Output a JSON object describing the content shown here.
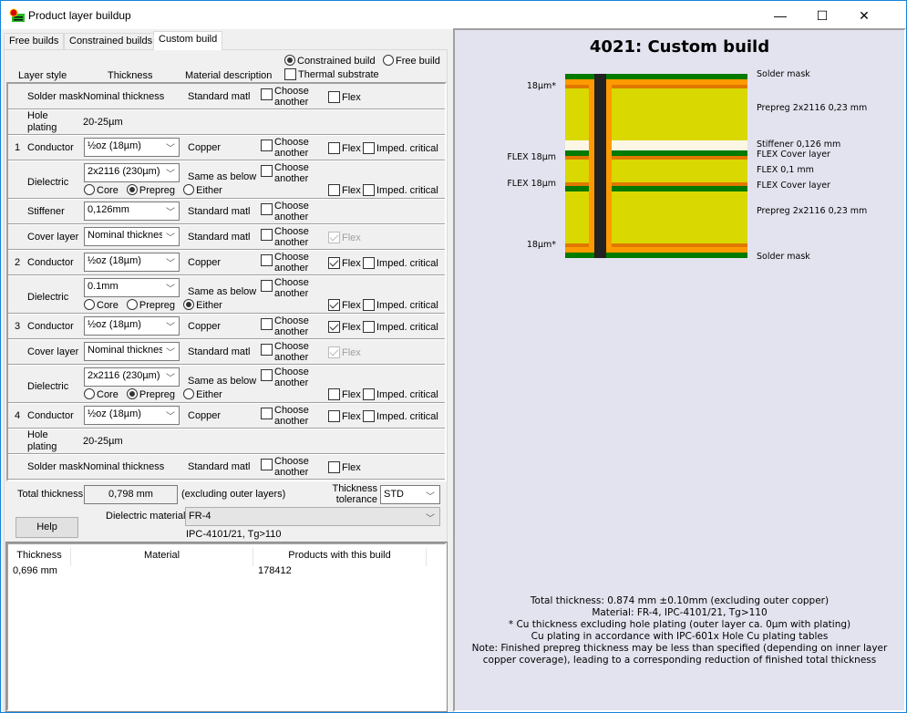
{
  "window": {
    "title": "Product layer buildup",
    "controls": {
      "minimize": "—",
      "maximize": "☐",
      "close": "✕"
    }
  },
  "tabs": [
    {
      "label": "Free builds",
      "active": false
    },
    {
      "label": "Constrained builds",
      "active": false
    },
    {
      "label": "Custom build",
      "active": true
    }
  ],
  "build_mode": {
    "options": [
      {
        "label": "Constrained build",
        "selected": true
      },
      {
        "label": "Free build",
        "selected": false
      }
    ],
    "thermal_substrate": {
      "label": "Thermal substrate",
      "checked": false
    }
  },
  "column_headers": {
    "layer_style": "Layer style",
    "thickness": "Thickness",
    "material": "Material description"
  },
  "common": {
    "choose_line1": "Choose",
    "choose_line2": "another",
    "flex": "Flex",
    "imped": "Imped. critical",
    "radio_core": "Core",
    "radio_prepreg": "Prepreg",
    "radio_either": "Either"
  },
  "layers": [
    {
      "kind": "solder",
      "style": "Solder mask",
      "thickness": "Nominal thickness",
      "material": "Standard matl",
      "choose": false,
      "flex": false
    },
    {
      "kind": "hole",
      "style_line1": "Hole",
      "style_line2": "plating",
      "thickness": "20-25µm"
    },
    {
      "kind": "conductor",
      "num": "1",
      "style": "Conductor",
      "thickness": "½oz (18µm)",
      "material": "Copper",
      "choose": false,
      "flex": false,
      "imped": false
    },
    {
      "kind": "dielectric",
      "style": "Dielectric",
      "thickness": "2x2116 (230µm)",
      "material": "Same as below",
      "choose": false,
      "type": "Prepreg",
      "flex": false,
      "imped": false
    },
    {
      "kind": "stiffener",
      "style": "Stiffener",
      "thickness": "0,126mm",
      "material": "Standard matl",
      "choose": false
    },
    {
      "kind": "cover",
      "style": "Cover layer",
      "thickness": "Nominal thickness",
      "material": "Standard matl",
      "choose": false,
      "flex": true,
      "flex_disabled": true
    },
    {
      "kind": "conductor",
      "num": "2",
      "style": "Conductor",
      "thickness": "½oz (18µm)",
      "material": "Copper",
      "choose": false,
      "flex": true,
      "imped": false
    },
    {
      "kind": "dielectric",
      "style": "Dielectric",
      "thickness": "0.1mm",
      "material": "Same as below",
      "choose": false,
      "type": "Either",
      "flex": true,
      "imped": false
    },
    {
      "kind": "conductor",
      "num": "3",
      "style": "Conductor",
      "thickness": "½oz (18µm)",
      "material": "Copper",
      "choose": false,
      "flex": true,
      "imped": false
    },
    {
      "kind": "cover",
      "style": "Cover layer",
      "thickness": "Nominal thickness",
      "material": "Standard matl",
      "choose": false,
      "flex": true,
      "flex_disabled": true
    },
    {
      "kind": "dielectric",
      "style": "Dielectric",
      "thickness": "2x2116 (230µm)",
      "material": "Same as below",
      "choose": false,
      "type": "Prepreg",
      "flex": false,
      "imped": false
    },
    {
      "kind": "conductor",
      "num": "4",
      "style": "Conductor",
      "thickness": "½oz (18µm)",
      "material": "Copper",
      "choose": false,
      "flex": false,
      "imped": false
    },
    {
      "kind": "hole",
      "style_line1": "Hole",
      "style_line2": "plating",
      "thickness": "20-25µm"
    },
    {
      "kind": "solder",
      "style": "Solder mask",
      "thickness": "Nominal thickness",
      "material": "Standard matl",
      "choose": false,
      "flex": false
    }
  ],
  "summary": {
    "total_thickness_label": "Total thickness",
    "total_thickness_value": "0,798 mm",
    "excluding_note": "(excluding outer layers)",
    "tolerance_label_1": "Thickness",
    "tolerance_label_2": "tolerance",
    "tolerance_value": "STD",
    "help_label": "Help",
    "dielectric_label": "Dielectric material",
    "dielectric_value": "FR-4",
    "dielectric_spec": "IPC-4101/21, Tg>110"
  },
  "results_table": {
    "headers": [
      "Thickness",
      "Material",
      "Products with this build"
    ],
    "rows": [
      [
        "0,696 mm",
        "",
        "178412"
      ]
    ]
  },
  "preview": {
    "title": "4021: Custom build",
    "colors": {
      "solder_mask": "#007a00",
      "plating": "#ff9a00",
      "copper": "#e07800",
      "prepreg": "#d9d800",
      "stiffener": "#fbf7e4",
      "drill": "#222222",
      "background": "#e3e3ef"
    },
    "right_labels": [
      "Solder mask",
      "Prepreg 2x2116 0,23 mm",
      "Stiffener  0,126 mm",
      "FLEX Cover layer",
      "FLEX 0,1 mm",
      "FLEX Cover layer",
      "Prepreg 2x2116 0,23 mm",
      "Solder mask"
    ],
    "left_labels": [
      "18µm*",
      "FLEX 18µm",
      "FLEX 18µm",
      "18µm*"
    ],
    "notes": [
      "Total thickness: 0.874 mm ±0.10mm (excluding outer copper)",
      "Material: FR-4, IPC-4101/21, Tg>110",
      "* Cu thickness excluding hole plating (outer layer ca. 0µm with plating)",
      "Cu plating in accordance with IPC-601x Hole Cu plating tables",
      "Note: Finished prepreg thickness may be less than specified (depending on inner layer",
      "copper coverage), leading to a corresponding reduction of finished total thickness"
    ]
  }
}
